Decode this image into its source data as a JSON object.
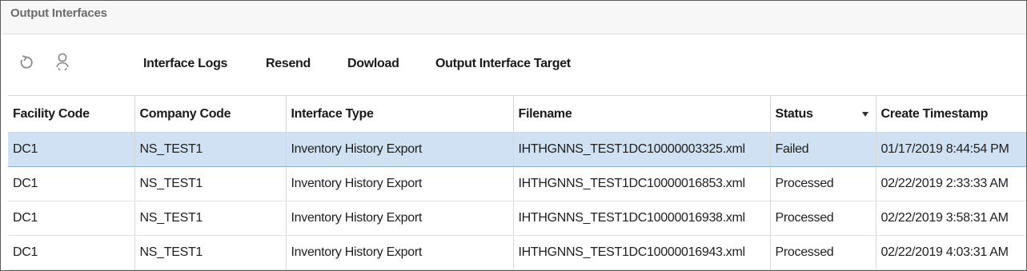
{
  "page": {
    "title": "Output Interfaces"
  },
  "toolbar": {
    "icons": [
      "refresh-icon",
      "user-search-icon"
    ],
    "buttons": [
      {
        "label": "Interface Logs"
      },
      {
        "label": "Resend"
      },
      {
        "label": "Dowload"
      },
      {
        "label": "Output Interface Target"
      }
    ]
  },
  "table": {
    "columns": [
      "Facility Code",
      "Company Code",
      "Interface Type",
      "Filename",
      "Status",
      "Create Timestamp"
    ],
    "sorted_column": "Status",
    "rows": [
      [
        "DC1",
        "NS_TEST1",
        "Inventory History Export",
        "IHTHGNNS_TEST1DC10000003325.xml",
        "Failed",
        "01/17/2019 8:44:54 PM"
      ],
      [
        "DC1",
        "NS_TEST1",
        "Inventory History Export",
        "IHTHGNNS_TEST1DC10000016853.xml",
        "Processed",
        "02/22/2019 2:33:33 AM"
      ],
      [
        "DC1",
        "NS_TEST1",
        "Inventory History Export",
        "IHTHGNNS_TEST1DC10000016938.xml",
        "Processed",
        "02/22/2019 3:58:31 AM"
      ],
      [
        "DC1",
        "NS_TEST1",
        "Inventory History Export",
        "IHTHGNNS_TEST1DC10000016943.xml",
        "Processed",
        "02/22/2019 4:03:31 AM"
      ]
    ],
    "selected_row": 0
  },
  "colors": {
    "selected_row": "#cfe1f2",
    "title_text": "#6b6b6b",
    "icon": "#8a8a8a"
  }
}
